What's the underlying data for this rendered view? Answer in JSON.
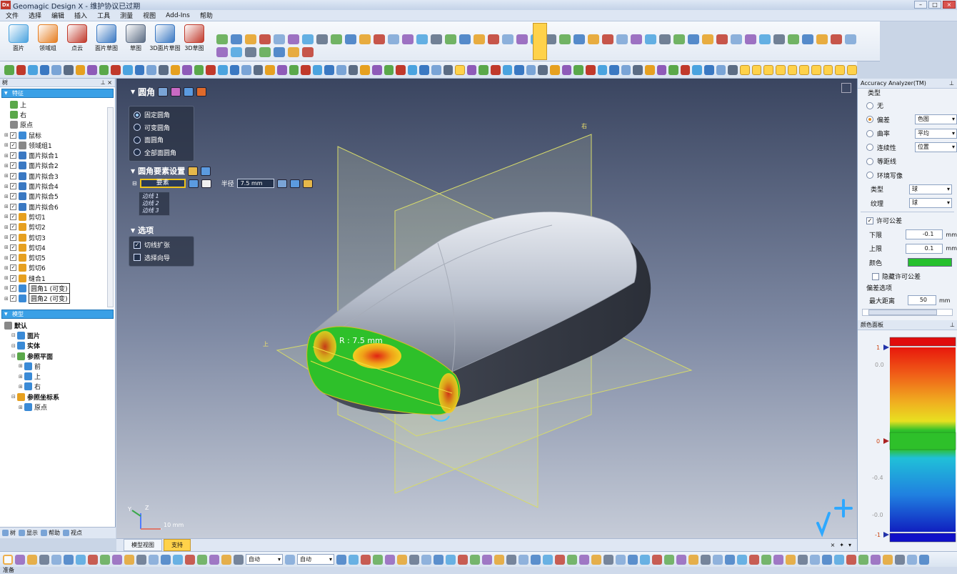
{
  "window": {
    "logo": "Dx",
    "title": "Geomagic Design X - 维护协议已过期"
  },
  "menu": [
    "文件",
    "选择",
    "编辑",
    "插入",
    "工具",
    "测量",
    "视图",
    "Add-Ins",
    "帮助"
  ],
  "ribbon": {
    "buttons": [
      {
        "label": "面片",
        "color": "#4aa3df"
      },
      {
        "label": "领域组",
        "color": "#e67e22"
      },
      {
        "label": "点云",
        "color": "#c0392b"
      },
      {
        "label": "面片草图",
        "color": "#3a78c2"
      },
      {
        "label": "草图",
        "color": "#5b6c84"
      },
      {
        "label": "3D面片草图",
        "color": "#3a78c2"
      },
      {
        "label": "3D草图",
        "color": "#c0392b"
      }
    ]
  },
  "tree": {
    "panel_title": "树",
    "features_header": "特征",
    "feature_items": [
      {
        "label": "上",
        "icon": "plane-icon",
        "color": "#5aa84a"
      },
      {
        "label": "右",
        "icon": "plane-icon",
        "color": "#5aa84a"
      },
      {
        "label": "原点",
        "icon": "origin-icon",
        "color": "#888888"
      },
      {
        "label": "鼠标",
        "icon": "mesh-icon",
        "color": "#3a8ad6"
      },
      {
        "label": "领域组1",
        "icon": "region-icon",
        "color": "#888888"
      },
      {
        "label": "面片拟合1",
        "icon": "surface-fit-icon",
        "color": "#3a78c2"
      },
      {
        "label": "面片拟合2",
        "icon": "surface-fit-icon",
        "color": "#3a78c2"
      },
      {
        "label": "面片拟合3",
        "icon": "surface-fit-icon",
        "color": "#3a78c2"
      },
      {
        "label": "面片拟合4",
        "icon": "surface-fit-icon",
        "color": "#3a78c2"
      },
      {
        "label": "面片拟合5",
        "icon": "surface-fit-icon",
        "color": "#3a78c2"
      },
      {
        "label": "面片拟合6",
        "icon": "surface-fit-icon",
        "color": "#3a78c2"
      },
      {
        "label": "剪切1",
        "icon": "trim-icon",
        "color": "#e6a020"
      },
      {
        "label": "剪切2",
        "icon": "trim-icon",
        "color": "#e6a020"
      },
      {
        "label": "剪切3",
        "icon": "trim-icon",
        "color": "#e6a020"
      },
      {
        "label": "剪切4",
        "icon": "trim-icon",
        "color": "#e6a020"
      },
      {
        "label": "剪切5",
        "icon": "trim-icon",
        "color": "#e6a020"
      },
      {
        "label": "剪切6",
        "icon": "trim-icon",
        "color": "#e6a020"
      },
      {
        "label": "缝合1",
        "icon": "sew-icon",
        "color": "#e6a020"
      },
      {
        "label": "圆角1 (可变)",
        "icon": "fillet-icon",
        "color": "#3a8ad6"
      },
      {
        "label": "圆角2 (可变)",
        "icon": "fillet-icon",
        "color": "#3a8ad6"
      }
    ],
    "model_header": "模型",
    "model_items": [
      {
        "label": "默认",
        "bold": true,
        "indent": 0
      },
      {
        "label": "面片",
        "bold": true,
        "indent": 1
      },
      {
        "label": "实体",
        "bold": true,
        "indent": 1
      },
      {
        "label": "参照平面",
        "bold": true,
        "indent": 1
      },
      {
        "label": "前",
        "bold": false,
        "indent": 2
      },
      {
        "label": "上",
        "bold": false,
        "indent": 2
      },
      {
        "label": "右",
        "bold": false,
        "indent": 2
      },
      {
        "label": "参照坐标系",
        "bold": true,
        "indent": 1
      },
      {
        "label": "原点",
        "bold": false,
        "indent": 2
      }
    ],
    "bottom_tabs": [
      "树",
      "显示",
      "帮助",
      "视点"
    ]
  },
  "dialog": {
    "title": "圆角",
    "fillet_types": [
      {
        "label": "固定圆角",
        "selected": true
      },
      {
        "label": "可变圆角",
        "selected": false
      },
      {
        "label": "面圆角",
        "selected": false
      },
      {
        "label": "全部面圆角",
        "selected": false
      }
    ],
    "settings_title": "圆角要素设置",
    "element_label": "要素",
    "radius_label": "半径",
    "radius_value": "7.5 mm",
    "edges": [
      "边线 1",
      "边线 2",
      "边线 3"
    ],
    "options_title": "选项",
    "options": [
      {
        "label": "切线扩张",
        "checked": true
      },
      {
        "label": "选择向导",
        "checked": false
      }
    ]
  },
  "viewport": {
    "plane_label_right": "右",
    "plane_label_top": "上",
    "radius_annotation": "R : 7.5 mm",
    "scale_label": "10 mm",
    "axis_x": "X",
    "axis_y": "Y",
    "axis_z": "Z"
  },
  "view_tabs": [
    "模型视图",
    "支持"
  ],
  "bottom_toolbar": {
    "combo1": "自动",
    "combo2": "自动"
  },
  "status": "准备",
  "accuracy": {
    "title": "Accuracy Analyzer(TM)",
    "type_group": "类型",
    "types": [
      {
        "label": "无",
        "selected": false,
        "value": ""
      },
      {
        "label": "偏差",
        "selected": true,
        "value": "色图"
      },
      {
        "label": "曲率",
        "selected": false,
        "value": "平均"
      },
      {
        "label": "连续性",
        "selected": false,
        "value": "位置"
      },
      {
        "label": "等距线",
        "selected": false,
        "value": ""
      },
      {
        "label": "环境写像",
        "selected": false,
        "value": ""
      }
    ],
    "shape_label": "类型",
    "shape_value": "球",
    "texture_label": "纹理",
    "texture_value": "球",
    "tolerance_title": "许可公差",
    "lower_label": "下限",
    "lower_value": "-0.1",
    "upper_label": "上限",
    "upper_value": "0.1",
    "unit": "mm",
    "color_label": "颜色",
    "tolerance_color": "#26c02e",
    "hide_tolerance_label": "隐藏许可公差",
    "deviation_options_title": "偏差选项",
    "max_distance_label": "最大距离",
    "max_distance_value": "50",
    "colorbar_title": "颜色面板",
    "colorbar_labels": [
      "1",
      "0.0",
      "0",
      "-0.4",
      "-0.0",
      "-1"
    ]
  }
}
